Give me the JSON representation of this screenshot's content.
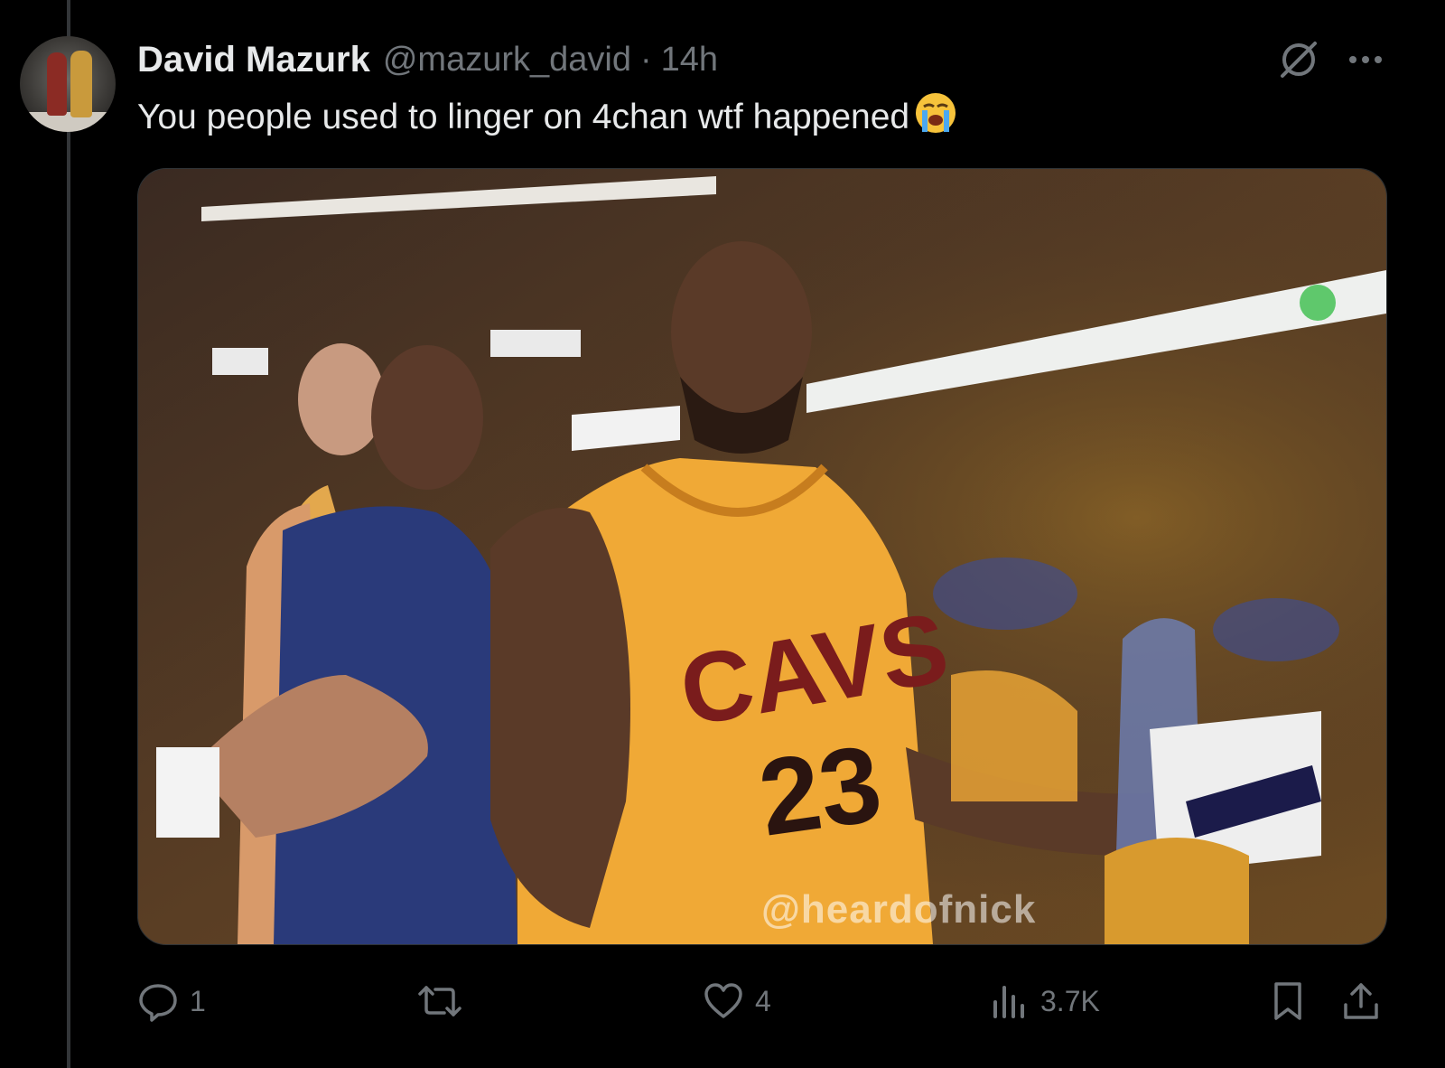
{
  "tweet": {
    "author_name": "David Mazurk",
    "handle": "@mazurk_david",
    "separator": "·",
    "time": "14h",
    "text": "You people used to linger on 4chan wtf happened",
    "emoji": "😭"
  },
  "media": {
    "icon": "gif-image",
    "watermark": "@heardofnick",
    "jersey_text": "CAVS",
    "jersey_number": "23"
  },
  "actions": {
    "replies": "1",
    "reposts": "",
    "likes": "4",
    "views": "3.7K"
  },
  "colors": {
    "background": "#000000",
    "text": "#e7e9ea",
    "muted": "#71767b",
    "jersey": "#f0a936"
  }
}
